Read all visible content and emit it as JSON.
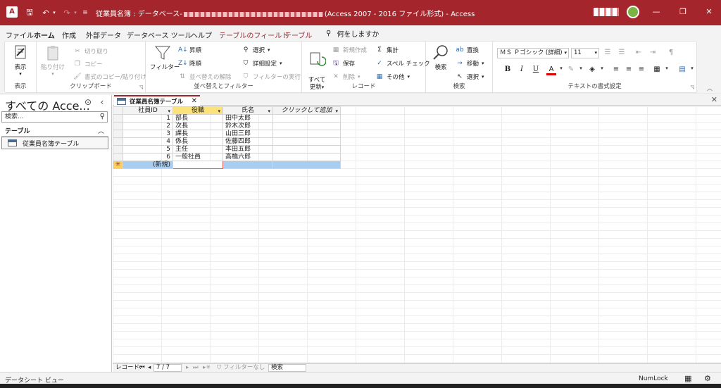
{
  "titlebar": {
    "app_icon": "A",
    "title_prefix": "従業員名簿 : データベース-",
    "title_suffix": "(Access 2007 - 2016 ファイル形式)  -  Access",
    "save_icon": "🖫",
    "undo_icon": "↶",
    "redo_icon": "↷",
    "dropdown_icon": "▾",
    "qat_icon": "≡",
    "minimize": "—",
    "restore": "❐",
    "close": "✕"
  },
  "menu": {
    "tabs": [
      "ファイル",
      "ホーム",
      "作成",
      "外部データ",
      "データベース ツール",
      "ヘルプ",
      "テーブルのフィールド",
      "テーブル"
    ],
    "tell_me": "何をしますか",
    "tell_me_icon": "⚲"
  },
  "ribbon": {
    "view": {
      "label": "表示",
      "group": "表示"
    },
    "clipboard": {
      "paste": "貼り付け",
      "cut": "切り取り",
      "copy": "コピー",
      "format_painter": "書式のコピー/貼り付け",
      "group": "クリップボード"
    },
    "sort": {
      "filter": "フィルター",
      "ascending": "昇順",
      "descending": "降順",
      "clear_sort": "並べ替えの解除",
      "selection": "選択",
      "advanced": "詳細設定",
      "toggle_filter": "フィルターの実行",
      "group": "並べ替えとフィルター"
    },
    "records": {
      "refresh": "すべて\n更新",
      "new": "新規作成",
      "save": "保存",
      "delete": "削除",
      "totals": "集計",
      "spelling": "スペル チェック",
      "more": "その他",
      "group": "レコード"
    },
    "find": {
      "find": "検索",
      "replace": "置換",
      "goto": "移動",
      "select": "選択",
      "group": "検索"
    },
    "text_format": {
      "font": "ＭＳ Ｐゴシック (詳細)",
      "size": "11",
      "group": "テキストの書式設定"
    }
  },
  "nav": {
    "title": "すべての Acce...",
    "search_placeholder": "検索...",
    "section": "テーブル",
    "items": [
      {
        "label": "従業員名簿テーブル"
      }
    ]
  },
  "document": {
    "tab_label": "従業員名簿テーブル",
    "columns": [
      "社員ID",
      "役職",
      "氏名",
      "クリックして追加"
    ],
    "rows": [
      {
        "id": "1",
        "role": "部長",
        "name": "田中太郎"
      },
      {
        "id": "2",
        "role": "次長",
        "name": "鈴木次郎"
      },
      {
        "id": "3",
        "role": "課長",
        "name": "山田三郎"
      },
      {
        "id": "4",
        "role": "係長",
        "name": "佐藤四郎"
      },
      {
        "id": "5",
        "role": "主任",
        "name": "本田五郎"
      },
      {
        "id": "6",
        "role": "一般社員",
        "name": "高橋六郎"
      }
    ],
    "new_row_label": "(新規)",
    "new_row_marker": "✳"
  },
  "record_nav": {
    "label": "レコード:",
    "position": "7 / 7",
    "filter": "フィルターなし",
    "search": "検索"
  },
  "status": {
    "view_name": "データシート ビュー",
    "numlock": "NumLock"
  },
  "colors": {
    "accent": "#a4262c",
    "selected_header": "#fce27a",
    "new_row": "#a9cdf0"
  }
}
